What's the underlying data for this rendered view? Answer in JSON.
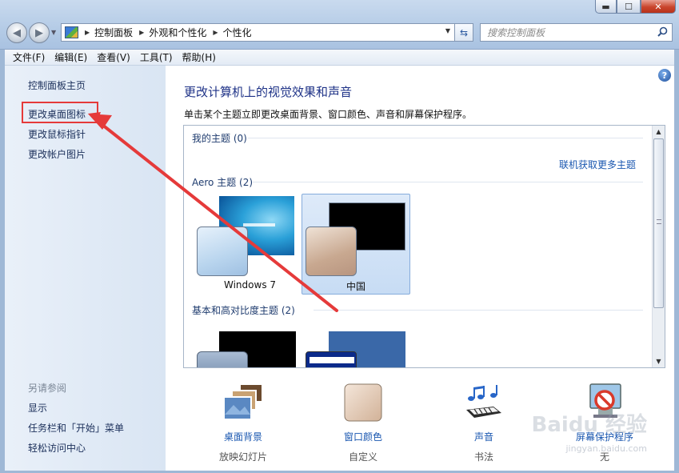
{
  "window": {
    "close_glyph": "✕",
    "max_glyph": "☐",
    "min_glyph": "▬"
  },
  "address": {
    "crumbs": [
      "控制面板",
      "外观和个性化",
      "个性化"
    ],
    "search_placeholder": "搜索控制面板"
  },
  "menubar": [
    "文件(F)",
    "编辑(E)",
    "查看(V)",
    "工具(T)",
    "帮助(H)"
  ],
  "leftpane": {
    "home": "控制面板主页",
    "links": [
      "更改桌面图标",
      "更改鼠标指针",
      "更改帐户图片"
    ],
    "see_also_head": "另请参阅",
    "see_also": [
      "显示",
      "任务栏和「开始」菜单",
      "轻松访问中心"
    ]
  },
  "main": {
    "title": "更改计算机上的视觉效果和声音",
    "desc": "单击某个主题立即更改桌面背景、窗口颜色、声音和屏幕保护程序。",
    "sections": {
      "my_themes": "我的主题 (0)",
      "online_link": "联机获取更多主题",
      "aero": "Aero 主题 (2)",
      "basic": "基本和高对比度主题 (2)"
    },
    "themes": [
      "Windows 7",
      "中国"
    ],
    "selected_theme": "中国"
  },
  "bottom": [
    {
      "label": "桌面背景",
      "sub": "放映幻灯片",
      "icon": "desktop-background-icon"
    },
    {
      "label": "窗口颜色",
      "sub": "自定义",
      "icon": "window-color-icon"
    },
    {
      "label": "声音",
      "sub": "书法",
      "icon": "sound-icon"
    },
    {
      "label": "屏幕保护程序",
      "sub": "无",
      "icon": "screensaver-icon"
    }
  ],
  "watermark": {
    "text": "Baidu 经验",
    "sub": "jingyan.baidu.com"
  },
  "colors": {
    "annotation": "#e53a3a",
    "link": "#1a57b0",
    "title": "#1e3287"
  }
}
